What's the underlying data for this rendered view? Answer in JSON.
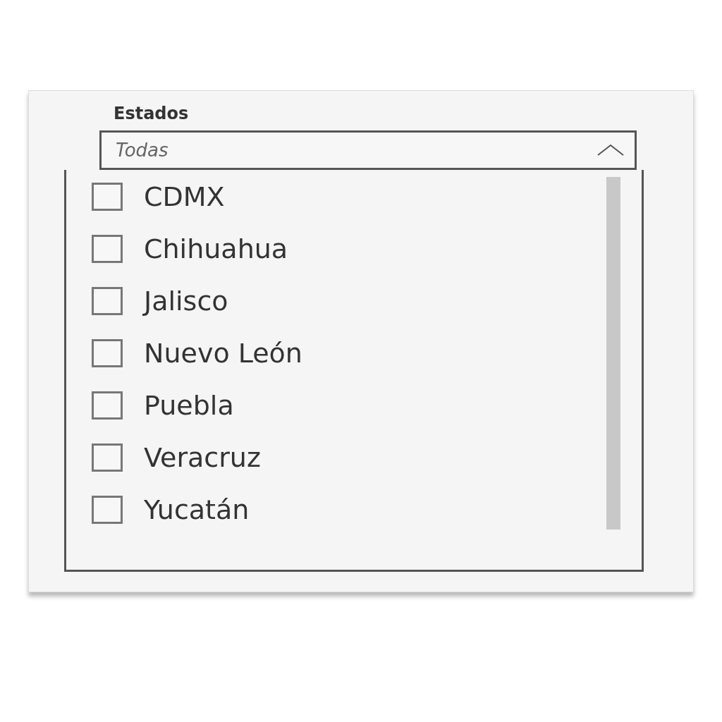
{
  "slicer": {
    "title": "Estados",
    "dropdown": {
      "value": "Todas",
      "expanded": true
    },
    "items": [
      {
        "label": "CDMX",
        "checked": false
      },
      {
        "label": "Chihuahua",
        "checked": false
      },
      {
        "label": "Jalisco",
        "checked": false
      },
      {
        "label": "Nuevo León",
        "checked": false
      },
      {
        "label": "Puebla",
        "checked": false
      },
      {
        "label": "Veracruz",
        "checked": false
      },
      {
        "label": "Yucatán",
        "checked": false
      }
    ]
  }
}
